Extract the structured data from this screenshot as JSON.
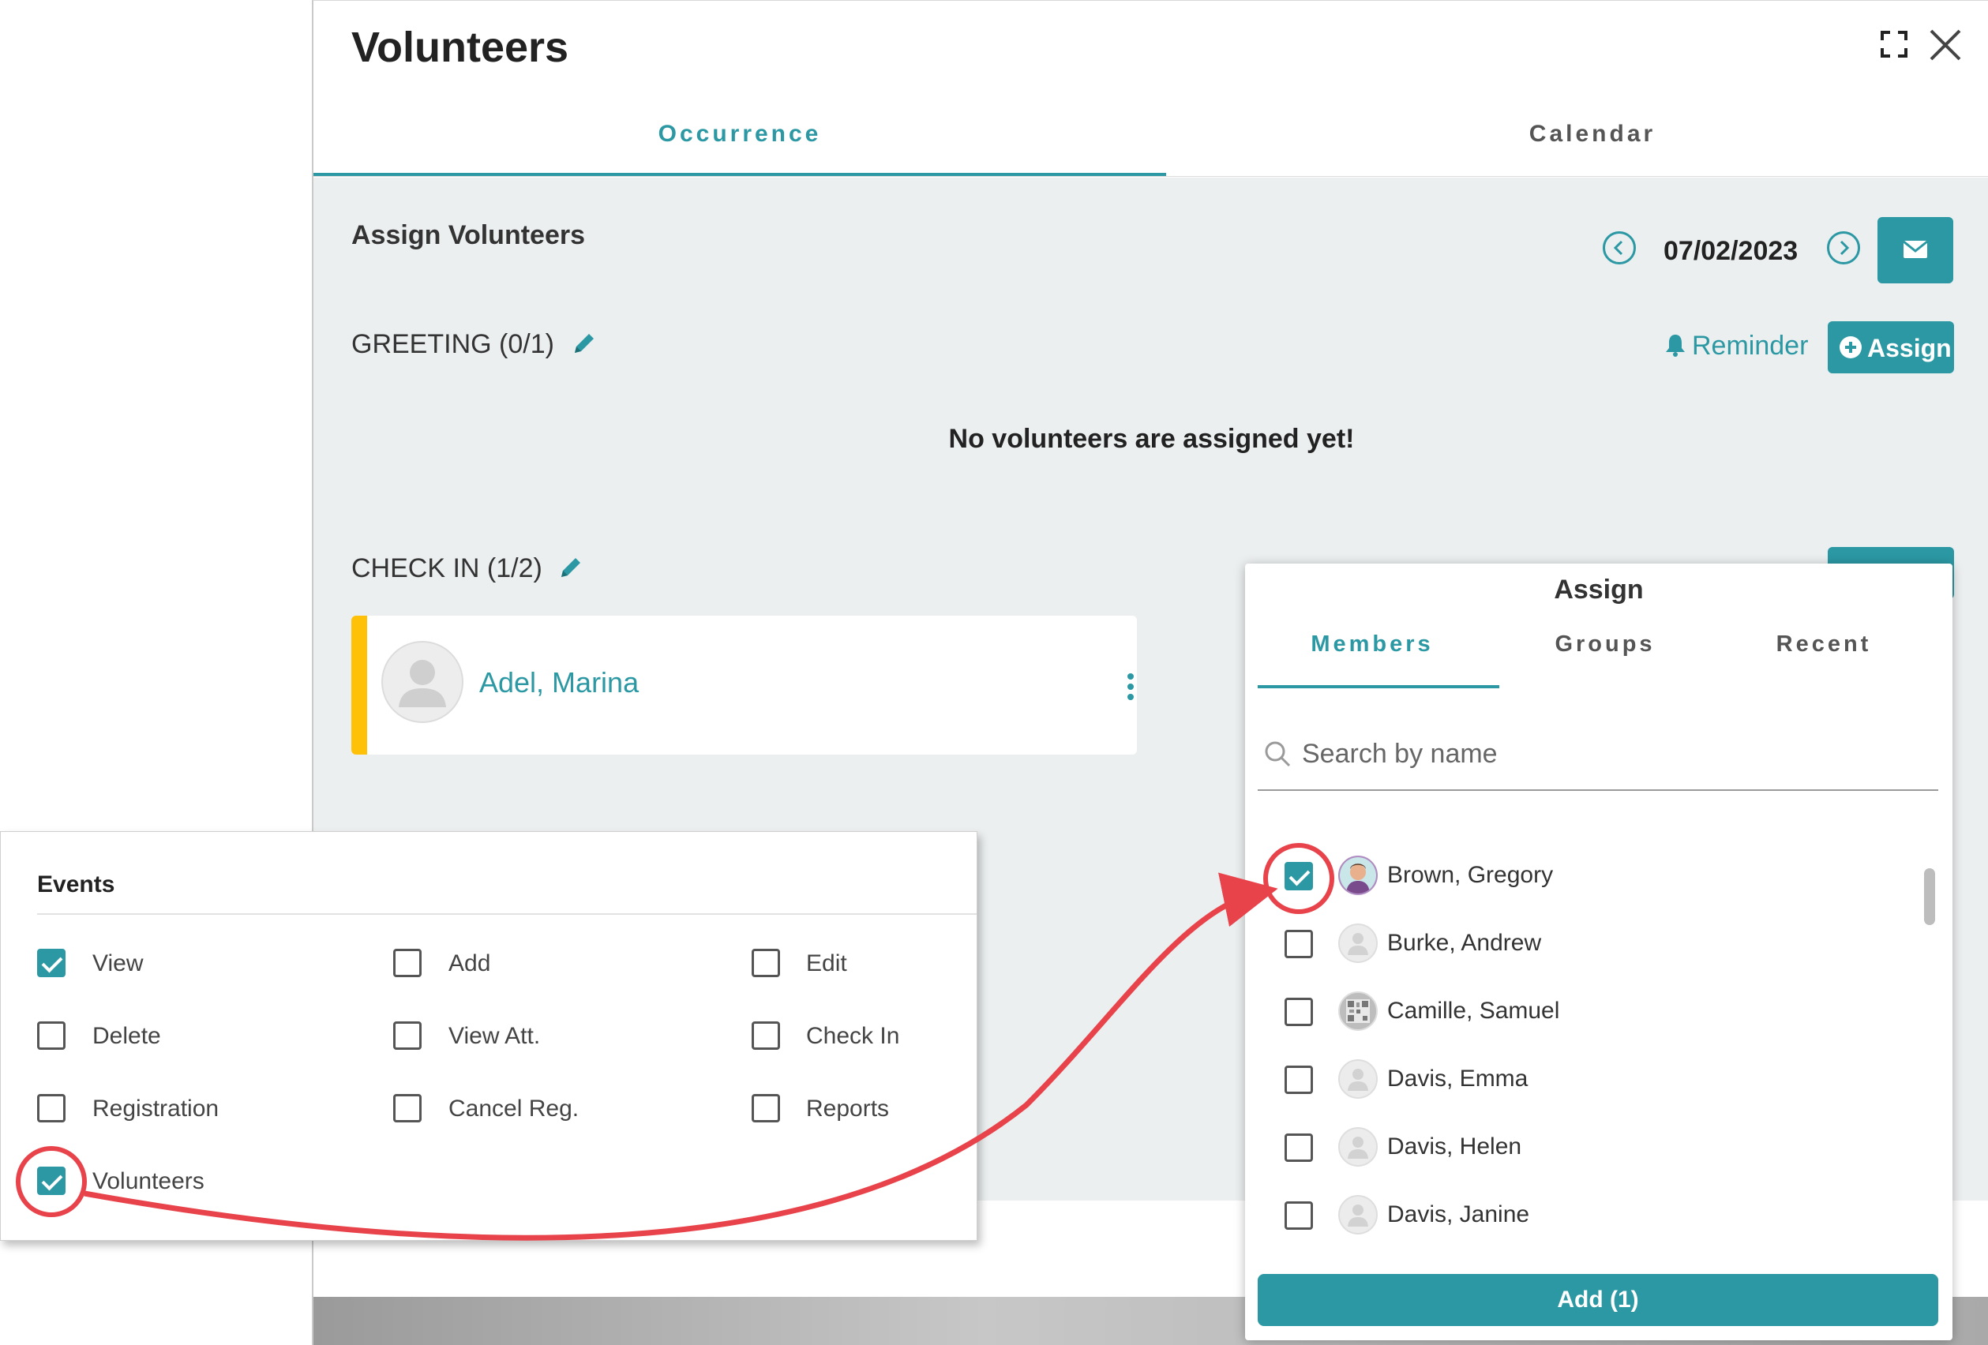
{
  "window": {
    "title": "Volunteers",
    "tabs": [
      {
        "label": "Occurrence",
        "active": true
      },
      {
        "label": "Calendar",
        "active": false
      }
    ]
  },
  "assign_section": {
    "title": "Assign Volunteers",
    "date": "07/02/2023"
  },
  "greeting": {
    "title": "GREETING (0/1)",
    "reminder_label": "Reminder",
    "assign_label": "Assign",
    "empty_message": "No volunteers are assigned yet!"
  },
  "check_in": {
    "title": "CHECK IN (1/2)",
    "volunteer_name": "Adel, Marina"
  },
  "events_card": {
    "title": "Events",
    "permissions": [
      {
        "label": "View",
        "checked": true
      },
      {
        "label": "Add",
        "checked": false
      },
      {
        "label": "Edit",
        "checked": false
      },
      {
        "label": "Delete",
        "checked": false
      },
      {
        "label": "View Att.",
        "checked": false
      },
      {
        "label": "Check In",
        "checked": false
      },
      {
        "label": "Registration",
        "checked": false
      },
      {
        "label": "Cancel Reg.",
        "checked": false
      },
      {
        "label": "Reports",
        "checked": false
      },
      {
        "label": "Volunteers",
        "checked": true
      }
    ]
  },
  "assign_popup": {
    "title": "Assign",
    "tabs": [
      {
        "label": "Members",
        "active": true
      },
      {
        "label": "Groups",
        "active": false
      },
      {
        "label": "Recent",
        "active": false
      }
    ],
    "search_placeholder": "Search by name",
    "members": [
      {
        "name": "Brown, Gregory",
        "checked": true,
        "avatar": "photo"
      },
      {
        "name": "Burke, Andrew",
        "checked": false,
        "avatar": "placeholder"
      },
      {
        "name": "Camille, Samuel",
        "checked": false,
        "avatar": "qr-photo"
      },
      {
        "name": "Davis, Emma",
        "checked": false,
        "avatar": "placeholder"
      },
      {
        "name": "Davis, Helen",
        "checked": false,
        "avatar": "placeholder"
      },
      {
        "name": "Davis, Janine",
        "checked": false,
        "avatar": "placeholder"
      }
    ],
    "add_button_label": "Add (1)"
  },
  "colors": {
    "accent": "#2b98a3",
    "card_bar": "#ffc107",
    "annotation": "#e8434b"
  }
}
